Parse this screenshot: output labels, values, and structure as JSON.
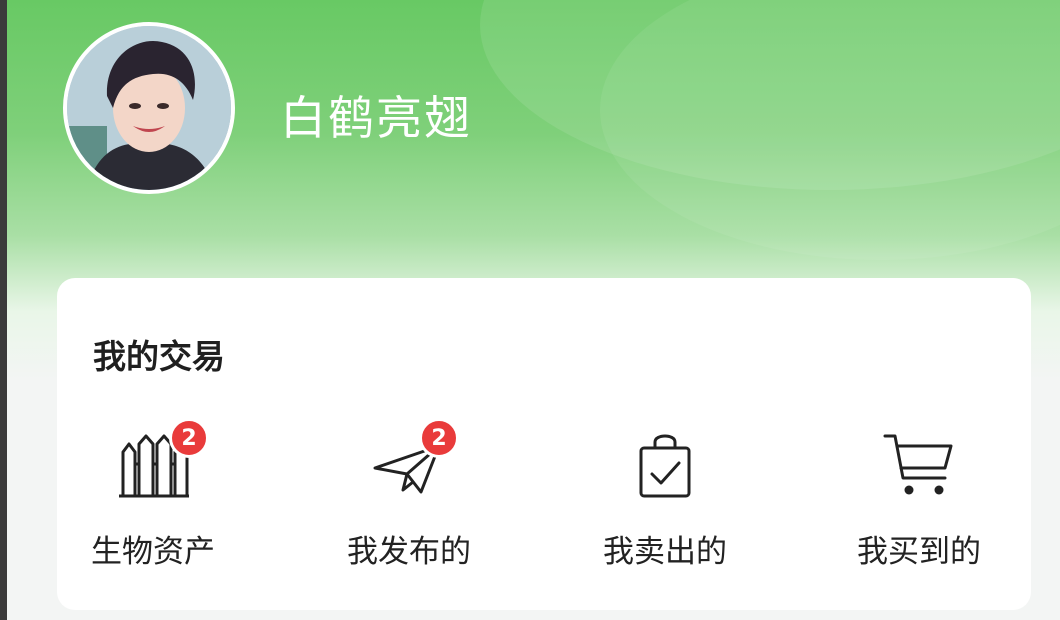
{
  "profile": {
    "username": "白鹤亮翅"
  },
  "trade_section": {
    "title": "我的交易",
    "items": [
      {
        "label": "生物资产",
        "icon": "fence-icon",
        "badge": "2"
      },
      {
        "label": "我发布的",
        "icon": "paper-plane-icon",
        "badge": "2"
      },
      {
        "label": "我卖出的",
        "icon": "shopping-bag-check-icon",
        "badge": ""
      },
      {
        "label": "我买到的",
        "icon": "shopping-cart-icon",
        "badge": ""
      }
    ]
  },
  "colors": {
    "header_green": "#68c964",
    "badge_red": "#e93b3b",
    "card_bg": "#ffffff"
  }
}
